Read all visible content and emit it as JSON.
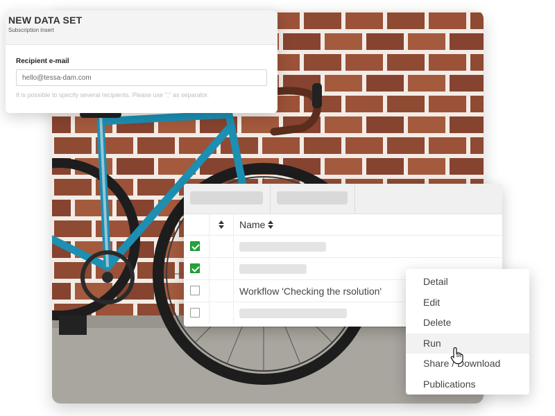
{
  "form": {
    "title": "NEW DATA SET",
    "subtitle": "Subscription insert",
    "field_label": "Recipient e-mail",
    "field_value": "hello@tessa-dam.com",
    "hint": "It is possible to specify several recipients. Please use \";\" as separator."
  },
  "table": {
    "column_name": "Name",
    "rows": [
      {
        "checked": true,
        "text": ""
      },
      {
        "checked": true,
        "text": ""
      },
      {
        "checked": false,
        "text": "Workflow 'Checking the rsolution'"
      },
      {
        "checked": false,
        "text": ""
      }
    ]
  },
  "menu": {
    "items": [
      "Detail",
      "Edit",
      "Delete",
      "Run",
      "Share / Download",
      "Publications"
    ],
    "hovered": "Run"
  },
  "colors": {
    "check_green": "#22a43b",
    "brick": "#8e4a33",
    "bike_frame": "#1c8fb3"
  },
  "icons": {
    "sort": "sort-icon",
    "checkbox": "checkbox-icon",
    "cursor": "hand-cursor-icon"
  }
}
